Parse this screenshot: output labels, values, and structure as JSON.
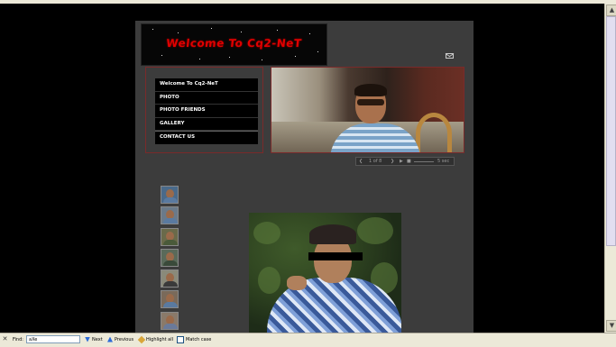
{
  "site": {
    "banner_title": "Welcome To Cq2-NeT",
    "menu": [
      {
        "label": "Welcome To Cq2-NeT"
      },
      {
        "label": "PHOTO"
      },
      {
        "label": "PHOTO FRIENDS"
      },
      {
        "label": "GALLERY"
      },
      {
        "label": "CONTACT US"
      }
    ],
    "slideshow": {
      "counter": "1 of 8",
      "speed": "5 sec"
    },
    "thumbnail_count": 7
  },
  "findbar": {
    "find_label": "Find:",
    "search_value": "aXe",
    "next_label": "Next",
    "previous_label": "Previous",
    "highlight_label": "Highlight all",
    "match_case_label": "Match case"
  },
  "colors": {
    "page_background": "#000000",
    "content_background": "#3c3c3c",
    "banner_text": "#e00000",
    "panel_border": "#7a2a2a",
    "findbar_background": "#ece9d8"
  },
  "icons": [
    "mail-icon",
    "close-icon",
    "arrow-down-icon",
    "arrow-up-icon",
    "highlighter-icon",
    "prev-icon",
    "next-icon",
    "play-icon",
    "stop-icon"
  ]
}
